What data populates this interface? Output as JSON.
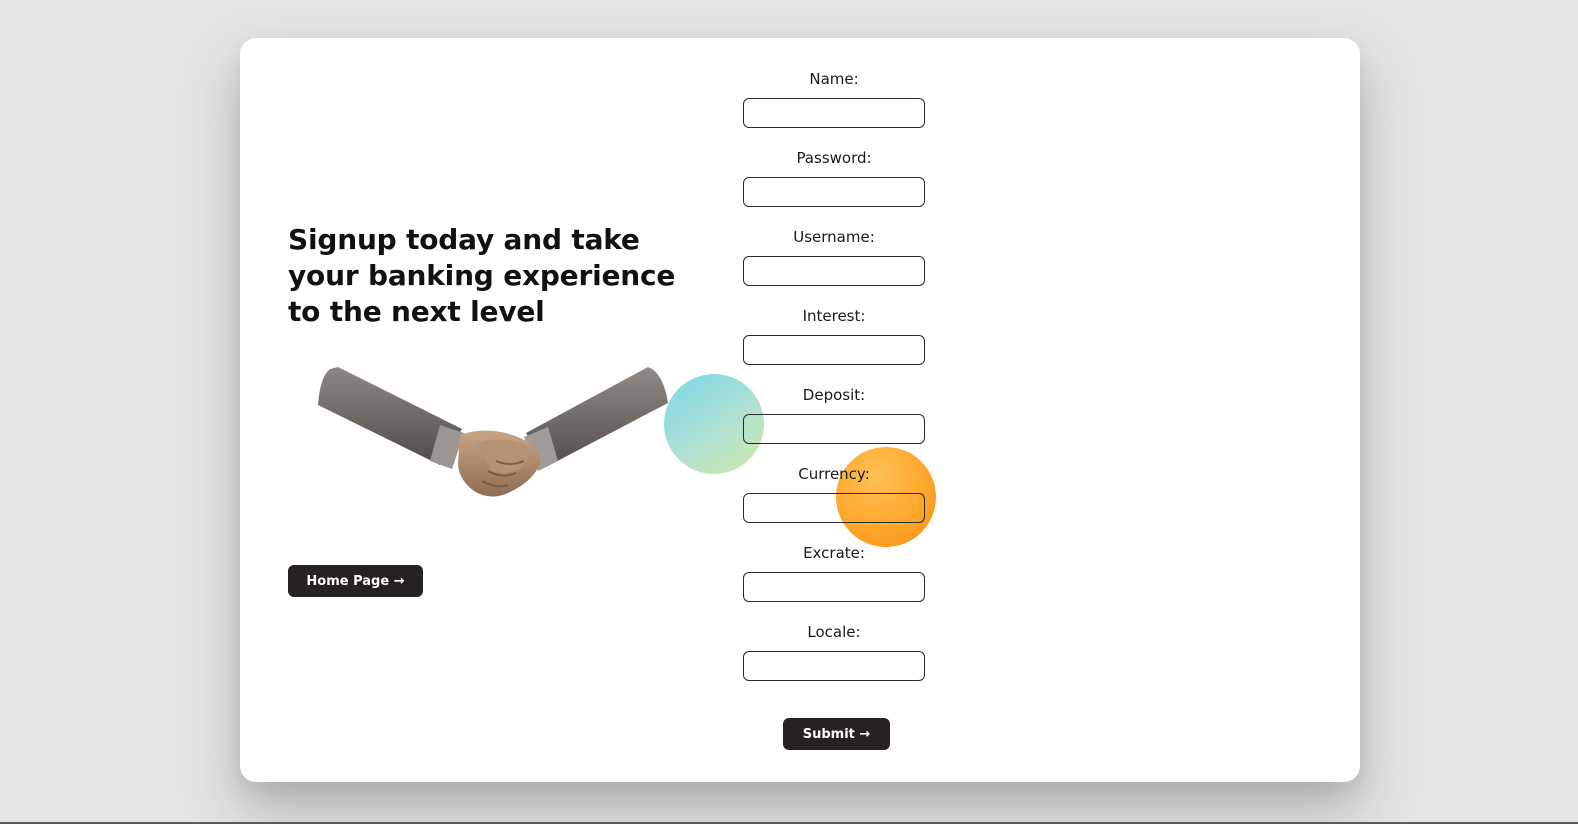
{
  "hero": {
    "headline": "Signup today and take your banking experience to the next level",
    "image": "handshake-illustration",
    "home_button_label": "Home Page →"
  },
  "form": {
    "fields": [
      {
        "label": "Name:",
        "value": "",
        "placeholder": ""
      },
      {
        "label": "Password:",
        "value": "",
        "placeholder": ""
      },
      {
        "label": "Username:",
        "value": "",
        "placeholder": ""
      },
      {
        "label": "Interest:",
        "value": "",
        "placeholder": ""
      },
      {
        "label": "Deposit:",
        "value": "",
        "placeholder": ""
      },
      {
        "label": "Currency:",
        "value": "",
        "placeholder": ""
      },
      {
        "label": "Excrate:",
        "value": "",
        "placeholder": ""
      },
      {
        "label": "Locale:",
        "value": "",
        "placeholder": ""
      }
    ],
    "submit_label": "Submit →"
  },
  "colors": {
    "page_background": "#e5e5e5",
    "card_background": "#ffffff",
    "button_background": "#262222",
    "button_text": "#ffffff",
    "bubble_teal": "#7fd6dd",
    "bubble_orange": "#ffa72c"
  }
}
